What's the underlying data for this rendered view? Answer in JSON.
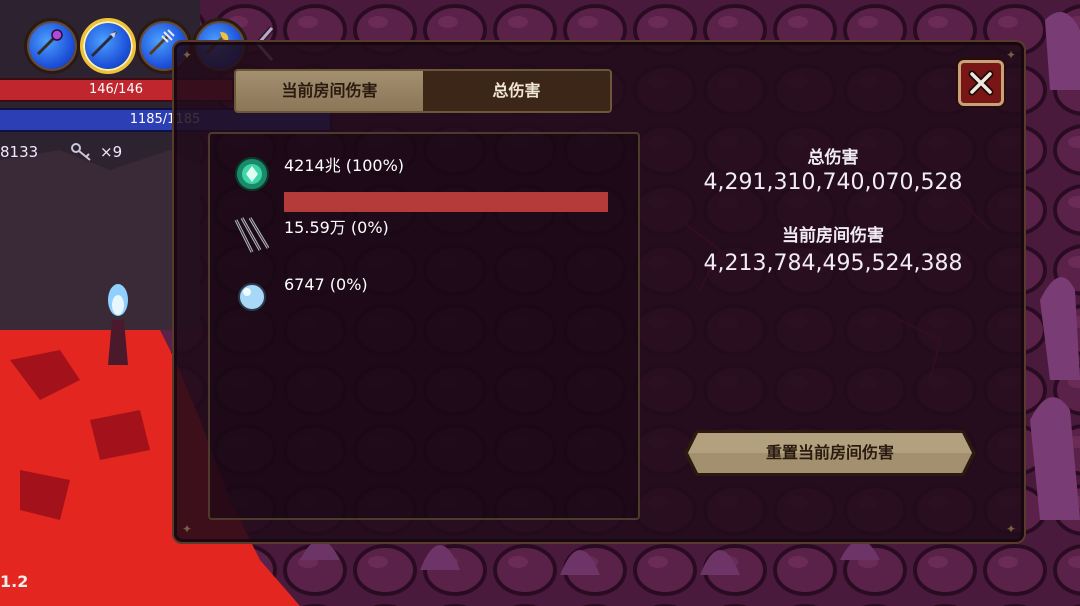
{
  "hud": {
    "weapons": [
      "staff-icon",
      "spear-icon",
      "trident-icon",
      "axe-staff-icon"
    ],
    "selected_weapon": 1,
    "hp_text": "146/146",
    "mp_text": "1185/1185",
    "gold_text": "8133",
    "key_text": "×9",
    "version": "1.2"
  },
  "tabs": [
    {
      "label": "当前房间伤害",
      "active": true
    },
    {
      "label": "总伤害",
      "active": false
    }
  ],
  "damage_list": [
    {
      "icon": "green-gem-icon",
      "text": "4214兆 (100%)",
      "percent": 100
    },
    {
      "icon": "spikes-icon",
      "text": "15.59万 (0%)",
      "percent": 0
    },
    {
      "icon": "pearl-icon",
      "text": "6747 (0%)",
      "percent": 0
    }
  ],
  "summary": {
    "total_label": "总伤害",
    "total_value": "4,291,310,740,070,528",
    "room_label": "当前房间伤害",
    "room_value": "4,213,784,495,524,388"
  },
  "reset_button": "重置当前房间伤害",
  "colors": {
    "bar_fill": "#b53a3a",
    "hp": "#c0262e",
    "mp": "#2d3fb5",
    "panel_bg": "#210c1a",
    "lava": "#e3261f"
  }
}
